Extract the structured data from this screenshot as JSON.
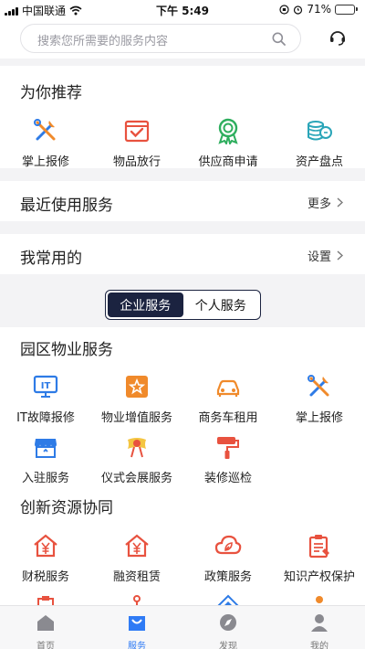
{
  "status_bar": {
    "carrier": "中国联通",
    "time": "下午 5:49",
    "battery_text": "71%",
    "battery_level": 0.71
  },
  "search": {
    "placeholder": "搜索您所需要的服务内容"
  },
  "recommended": {
    "title": "为你推荐",
    "items": [
      {
        "label": "掌上报修",
        "icon": "tools-icon"
      },
      {
        "label": "物品放行",
        "icon": "box-check-icon"
      },
      {
        "label": "供应商申请",
        "icon": "award-icon"
      },
      {
        "label": "资产盘点",
        "icon": "coins-icon"
      }
    ]
  },
  "recent": {
    "title": "最近使用服务",
    "more_label": "更多"
  },
  "favorites": {
    "title": "我常用的",
    "settings_label": "设置"
  },
  "service_toggle": {
    "options": [
      "企业服务",
      "个人服务"
    ],
    "active": 0
  },
  "park_services": {
    "title": "园区物业服务",
    "items": [
      {
        "label": "IT故障报修",
        "icon": "it-monitor-icon"
      },
      {
        "label": "物业增值服务",
        "icon": "star-badge-icon"
      },
      {
        "label": "商务车租用",
        "icon": "car-icon"
      },
      {
        "label": "掌上报修",
        "icon": "tools-icon"
      },
      {
        "label": "入驻服务",
        "icon": "shop-icon"
      },
      {
        "label": "仪式会展服务",
        "icon": "ceremony-icon"
      },
      {
        "label": "装修巡检",
        "icon": "paint-roller-icon"
      }
    ]
  },
  "innovation": {
    "title": "创新资源协同",
    "items": [
      {
        "label": "财税服务",
        "icon": "yen-house-icon"
      },
      {
        "label": "融资租赁",
        "icon": "yen-house-icon"
      },
      {
        "label": "政策服务",
        "icon": "cloud-leaf-icon"
      },
      {
        "label": "知识产权保护",
        "icon": "document-icon"
      }
    ]
  },
  "tabbar": {
    "items": [
      {
        "label": "首页",
        "icon": "home-icon"
      },
      {
        "label": "服务",
        "icon": "service-icon"
      },
      {
        "label": "发现",
        "icon": "compass-icon"
      },
      {
        "label": "我的",
        "icon": "user-icon"
      }
    ],
    "active": 1
  },
  "colors": {
    "accent": "#2f7bf5",
    "icon_red": "#e8523f",
    "icon_blue": "#2e7be6",
    "icon_orange": "#f08a2b",
    "toggle_dark": "#1b2340"
  }
}
